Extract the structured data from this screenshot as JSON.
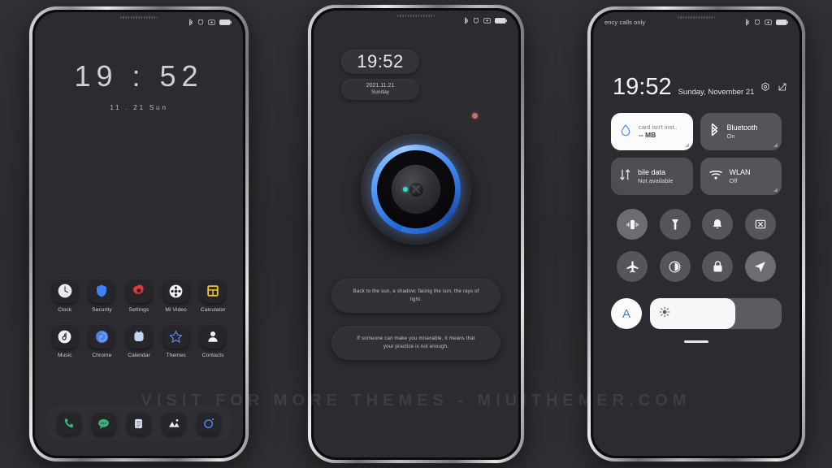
{
  "watermark": "VISIT FOR MORE THEMES - MIUITHEMER.COM",
  "colors": {
    "background": "#2e2e32",
    "screen": "#2c2c30",
    "accent_blue": "#4a8cfa",
    "tile_on": "#fbfbfb",
    "tile_off": "#53555a",
    "teal_dot": "#3fd9c8",
    "red_dot": "#c4706a",
    "calculator_yellow": "#f2c230",
    "settings_red": "#e03a3a",
    "security_blue": "#3b82f6"
  },
  "phone1": {
    "statusbar": {
      "left_text": "",
      "icons": [
        "bluetooth-icon",
        "alarm-icon",
        "vibrate-icon",
        "battery-icon"
      ]
    },
    "clock": "19 : 52",
    "date": "11 . 21   Sun",
    "apps": [
      {
        "label": "Clock",
        "icon": "clock-icon"
      },
      {
        "label": "Security",
        "icon": "shield-icon"
      },
      {
        "label": "Settings",
        "icon": "gear-icon"
      },
      {
        "label": "Mi Video",
        "icon": "film-reel-icon"
      },
      {
        "label": "Calculator",
        "icon": "calculator-icon"
      },
      {
        "label": "Music",
        "icon": "music-note-icon"
      },
      {
        "label": "Chrome",
        "icon": "chrome-icon"
      },
      {
        "label": "Calendar",
        "icon": "calendar-icon"
      },
      {
        "label": "Themes",
        "icon": "star-icon"
      },
      {
        "label": "Contacts",
        "icon": "person-icon"
      }
    ],
    "dock": [
      {
        "label": "Phone",
        "icon": "phone-handset-icon"
      },
      {
        "label": "Messages",
        "icon": "chat-bubble-icon"
      },
      {
        "label": "Notes",
        "icon": "notes-icon"
      },
      {
        "label": "Gallery",
        "icon": "gallery-mountain-icon"
      },
      {
        "label": "Browser",
        "icon": "browser-circle-icon"
      }
    ]
  },
  "phone2": {
    "statusbar": {
      "icons": [
        "bluetooth-icon",
        "alarm-icon",
        "vibrate-icon",
        "battery-icon"
      ]
    },
    "time": "19:52",
    "date": "2021.11.21",
    "weekday": "Sunday",
    "widget": "camera-ring-widget",
    "quotes": [
      "Back to the sun, a shadow; facing the sun, the rays of light.",
      "If someone can make you miserable, it means that your practice is not enough."
    ]
  },
  "phone3": {
    "statusbar": {
      "left_text": "ency calls only",
      "icons": [
        "bluetooth-icon",
        "alarm-icon",
        "vibrate-icon",
        "battery-icon"
      ]
    },
    "time": "19:52",
    "date": "Sunday, November 21",
    "header_icons": [
      "settings-gear-icon",
      "edit-icon"
    ],
    "tiles": [
      {
        "title": "card isn't inst..",
        "sub": "-- MB",
        "icon": "data-drop-icon",
        "state": "on"
      },
      {
        "title": "Bluetooth",
        "sub": "On",
        "icon": "bluetooth-icon",
        "state": "off"
      },
      {
        "title": "bile data",
        "sub": "Not available",
        "icon": "mobile-data-icon",
        "state": "dim"
      },
      {
        "title": "WLAN",
        "sub": "Off",
        "icon": "wifi-icon",
        "state": "off"
      }
    ],
    "toggles": [
      {
        "name": "vibrate-icon",
        "dim": false
      },
      {
        "name": "flashlight-icon",
        "dim": true
      },
      {
        "name": "bell-icon",
        "dim": true
      },
      {
        "name": "screenshot-icon",
        "dim": true
      },
      {
        "name": "airplane-icon",
        "dim": true
      },
      {
        "name": "dark-mode-icon",
        "dim": true
      },
      {
        "name": "lock-icon",
        "dim": true
      },
      {
        "name": "location-icon",
        "dim": false
      }
    ],
    "brightness": {
      "auto_label": "A",
      "value_percent": 65,
      "icon": "sun-brightness-icon"
    }
  }
}
